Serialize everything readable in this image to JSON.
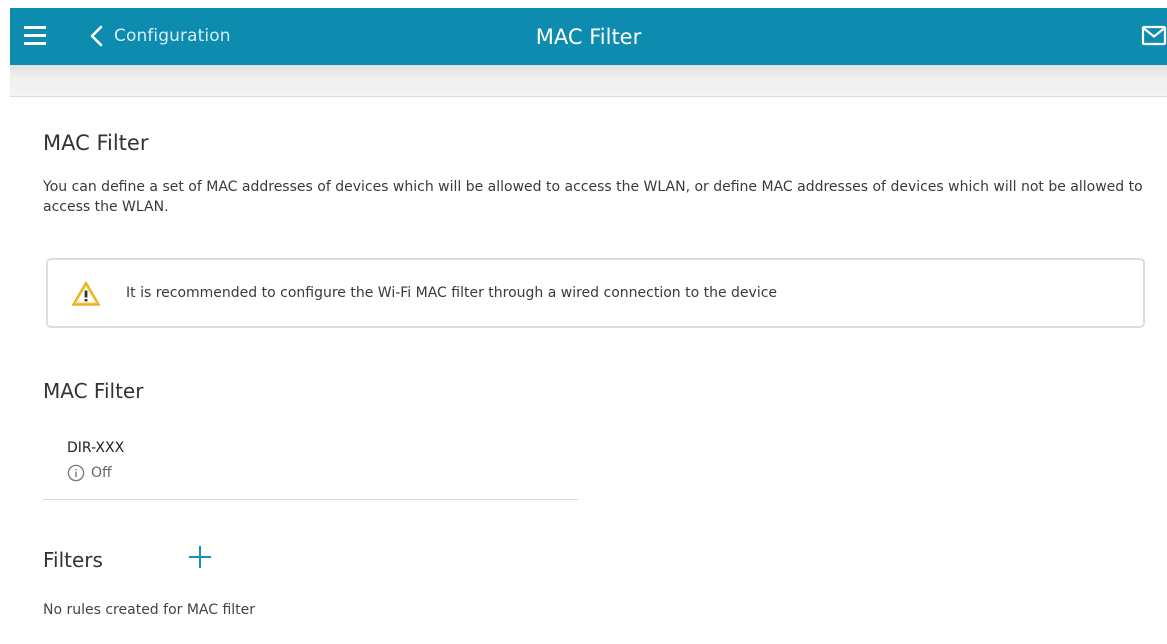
{
  "header": {
    "back_label": "Configuration",
    "title": "MAC Filter",
    "menu_icon": "hamburger-menu-icon",
    "back_icon": "chevron-left-icon",
    "mail_icon": "envelope-icon",
    "background_color": "#0d8cb0"
  },
  "main": {
    "title": "MAC Filter",
    "description": "You can define a set of MAC addresses of devices which will be allowed to access the WLAN, or define MAC addresses of devices which will not be allowed to access the WLAN.",
    "warning": {
      "icon": "warning-triangle-icon",
      "text": "It is recommended to configure the Wi-Fi MAC filter through a wired connection to the device"
    },
    "mac_filter_section": {
      "title": "MAC Filter",
      "device": {
        "name": "DIR-XXX",
        "status": "Off",
        "status_icon": "info-circle-icon"
      }
    },
    "filters_section": {
      "title": "Filters",
      "add_icon": "plus-icon",
      "empty_message": "No rules created for MAC filter"
    }
  }
}
